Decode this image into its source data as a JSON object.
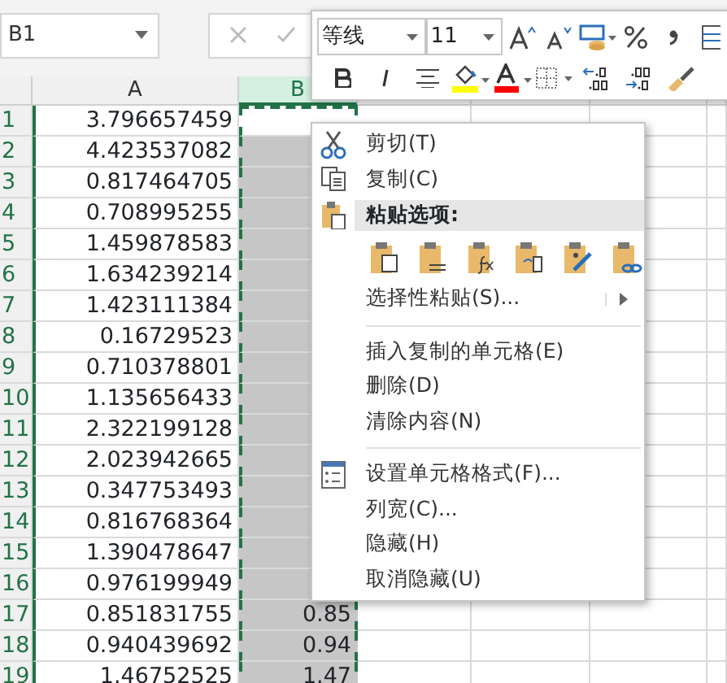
{
  "name_box": {
    "value": "B1"
  },
  "columns": [
    {
      "label": "A",
      "selected": false
    },
    {
      "label": "B",
      "selected": true
    }
  ],
  "rows": [
    {
      "number": "1",
      "a": "3.796657459",
      "active": true
    },
    {
      "number": "2",
      "a": "4.423537082",
      "active": false
    },
    {
      "number": "3",
      "a": "0.817464705",
      "active": false
    },
    {
      "number": "4",
      "a": "0.708995255",
      "active": false
    },
    {
      "number": "5",
      "a": "1.459878583",
      "active": false
    },
    {
      "number": "6",
      "a": "1.634239214",
      "active": false
    },
    {
      "number": "7",
      "a": "1.423111384",
      "active": false
    },
    {
      "number": "8",
      "a": "0.16729523",
      "active": false
    },
    {
      "number": "9",
      "a": "0.710378801",
      "active": false
    },
    {
      "number": "10",
      "a": "1.135656433",
      "active": false
    },
    {
      "number": "11",
      "a": "2.322199128",
      "active": false
    },
    {
      "number": "12",
      "a": "2.023942665",
      "active": false
    },
    {
      "number": "13",
      "a": "0.347753493",
      "active": false
    },
    {
      "number": "14",
      "a": "0.816768364",
      "active": false
    },
    {
      "number": "15",
      "a": "1.390478647",
      "active": false
    },
    {
      "number": "16",
      "a": "0.976199949",
      "active": false
    },
    {
      "number": "17",
      "a": "0.851831755",
      "b": "0.85",
      "active": false
    },
    {
      "number": "18",
      "a": "0.940439692",
      "b": "0.94",
      "active": false
    },
    {
      "number": "19",
      "a": "1.46752525",
      "b": "1.47",
      "active": false
    }
  ],
  "mini_toolbar": {
    "font": "等线",
    "size": "11"
  },
  "context_menu": [
    {
      "kind": "item",
      "label": "剪切(T)"
    },
    {
      "kind": "item",
      "label": "复制(C)"
    },
    {
      "kind": "header",
      "label": "粘贴选项:"
    },
    {
      "kind": "paste-options"
    },
    {
      "kind": "item",
      "label": "选择性粘贴(S)...",
      "submenu": true
    },
    {
      "kind": "separator"
    },
    {
      "kind": "item",
      "label": "插入复制的单元格(E)"
    },
    {
      "kind": "item",
      "label": "删除(D)"
    },
    {
      "kind": "item",
      "label": "清除内容(N)"
    },
    {
      "kind": "separator"
    },
    {
      "kind": "item",
      "label": "设置单元格格式(F)..."
    },
    {
      "kind": "item",
      "label": "列宽(C)..."
    },
    {
      "kind": "item",
      "label": "隐藏(H)"
    },
    {
      "kind": "item",
      "label": "取消隐藏(U)"
    }
  ]
}
